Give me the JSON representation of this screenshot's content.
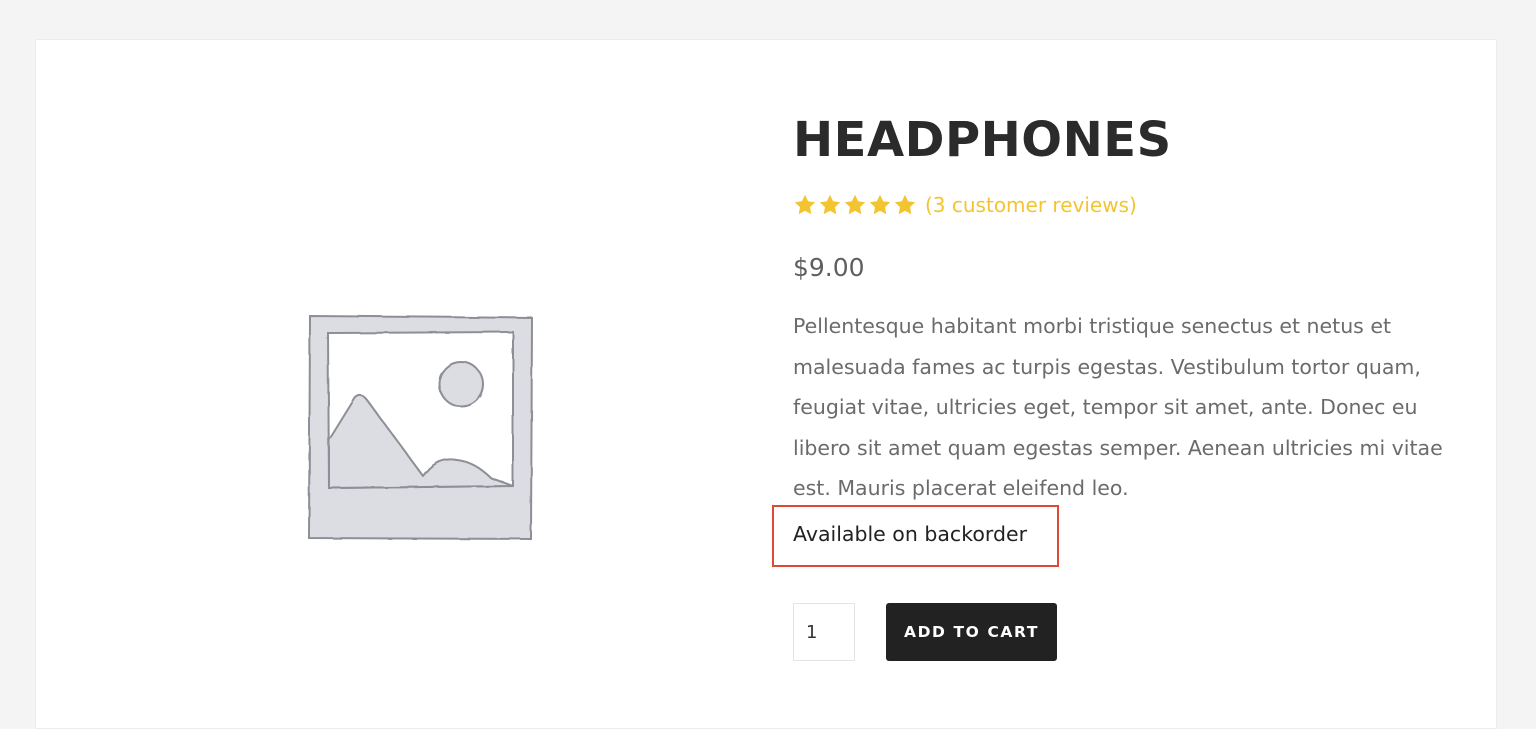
{
  "product": {
    "title": "HEADPHONES",
    "rating": {
      "value": 5,
      "max": 5
    },
    "reviews_link": "(3 customer reviews)",
    "price": "$9.00",
    "description": "Pellentesque habitant morbi tristique senectus et netus et malesuada fames ac turpis egestas. Vestibulum tortor quam, feugiat vitae, ultricies eget, tempor sit amet, ante. Donec eu libero sit amet quam egestas semper. Aenean ultricies mi vitae est. Mauris placerat eleifend leo.",
    "stock_status": "Available on backorder",
    "image_icon": "placeholder-image-icon"
  },
  "cart": {
    "quantity": "1",
    "add_to_cart_label": "ADD TO CART"
  },
  "colors": {
    "star": "#f2c530",
    "highlight_box": "#e04a33",
    "button_bg": "#222222"
  }
}
